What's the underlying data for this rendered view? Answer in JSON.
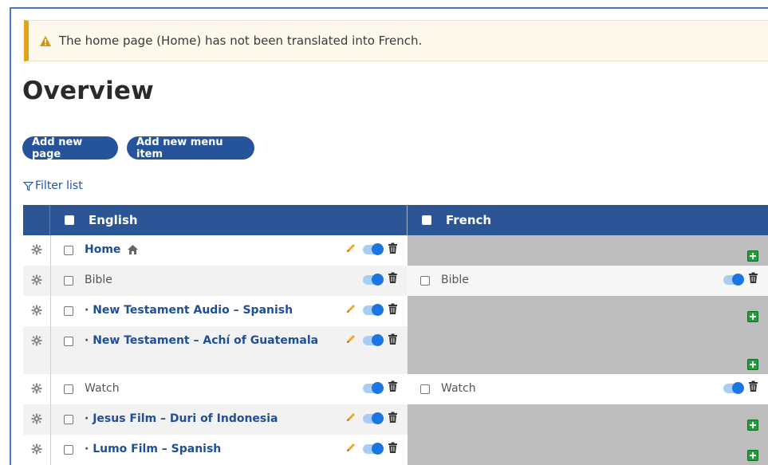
{
  "warning": {
    "icon": "warning-triangle-icon",
    "text": "The home page (Home) has not been translated into French."
  },
  "page_title": "Overview",
  "buttons": {
    "add_page": "Add new page",
    "add_menu_item": "Add new menu item"
  },
  "filter": {
    "icon": "filter-icon",
    "label": "Filter list"
  },
  "table": {
    "col_english": "English",
    "col_french": "French",
    "rows": [
      {
        "en_label": "Home",
        "en_link": true,
        "home_icon": true,
        "edit": true,
        "fr_label": ""
      },
      {
        "en_label": "Bible",
        "en_link": false,
        "edit": false,
        "fr_label": "Bible"
      },
      {
        "en_label": "· New Testament Audio – Spanish",
        "en_link": true,
        "edit": true,
        "fr_label": ""
      },
      {
        "en_label": "· New Testament – Achí of Guatemala",
        "en_link": true,
        "edit": true,
        "fr_label": ""
      },
      {
        "en_label": "Watch",
        "en_link": false,
        "edit": false,
        "fr_label": "Watch"
      },
      {
        "en_label": "· Jesus Film – Duri of Indonesia",
        "en_link": true,
        "edit": true,
        "fr_label": ""
      },
      {
        "en_label": "· Lumo Film – Spanish",
        "en_link": true,
        "edit": true,
        "fr_label": ""
      }
    ]
  },
  "colors": {
    "accent": "#25549b",
    "header_bg": "#2b5595",
    "warning_border": "#e3a21a",
    "toggle_on": "#1976e3",
    "untranslated_bg": "#bdbdbd",
    "add_translation": "#1f9e3a"
  }
}
